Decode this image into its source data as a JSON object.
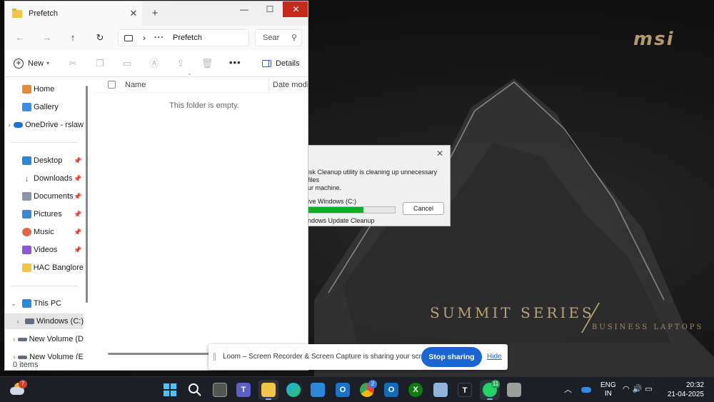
{
  "explorer": {
    "tab_title": "Prefetch",
    "address_current": "Prefetch",
    "search_placeholder": "Sear",
    "new_label": "New",
    "details_label": "Details",
    "column_name": "Name",
    "column_date": "Date modified",
    "empty_message": "This folder is empty.",
    "status_items": "0 items",
    "nav": {
      "home": "Home",
      "gallery": "Gallery",
      "onedrive": "OneDrive - rslaw",
      "desktop": "Desktop",
      "downloads": "Downloads",
      "documents": "Documents",
      "pictures": "Pictures",
      "music": "Music",
      "videos": "Videos",
      "hac": "HAC Banglore",
      "thispc": "This PC",
      "windows_c": "Windows (C:)",
      "newvol1": "New Volume (D",
      "newvol2": "New Volume (E"
    },
    "icons": {
      "back": "arrow-left-icon",
      "forward": "arrow-right-icon",
      "up": "arrow-up-icon",
      "refresh": "refresh-icon",
      "cut": "scissors-icon",
      "copy": "copy-icon",
      "paste": "clipboard-icon",
      "rename": "rename-icon",
      "share": "share-icon",
      "delete": "trash-icon",
      "more": "more-icon"
    }
  },
  "cleanup": {
    "message": "isk Cleanup utility is cleaning up unnecessary files\nur machine.",
    "drive": "ive Windows (C:)",
    "progress": 0.64,
    "cancel_label": "Cancel",
    "current_item": "ndows Update Cleanup"
  },
  "loom": {
    "text": "Loom – Screen Recorder & Screen Capture is sharing your screen.",
    "stop_label": "Stop sharing",
    "hide_label": "Hide"
  },
  "wallpaper": {
    "brand": "msi",
    "title": "SUMMIT SERIES",
    "subtitle": "BUSINESS LAPTOPS"
  },
  "taskbar": {
    "weather_badge": "7",
    "chrome_badge": "2",
    "whatsapp_badge": "11",
    "lang_top": "ENG",
    "lang_bottom": "IN",
    "time": "20:32",
    "date": "21-04-2025"
  },
  "colors": {
    "accent": "#1a66d2",
    "close_red": "#c42b1c",
    "progress_green": "#06b025",
    "taskbar": "#1c1f26"
  }
}
